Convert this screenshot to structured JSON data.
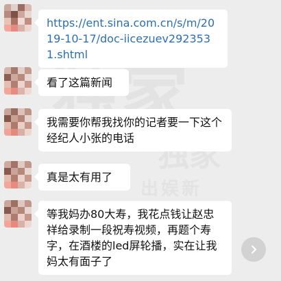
{
  "messages": [
    {
      "text": "https://ent.sina.com.cn/s/m/2019-10-17/doc-iicezuev2923531.shtml",
      "type": "link"
    },
    {
      "text": "看了这篇新闻",
      "type": "text"
    },
    {
      "text": "我需要你帮我找你的记者要一下这个经纪人小张的电话",
      "type": "text"
    },
    {
      "text": "真是太有用了",
      "type": "text"
    },
    {
      "text": "等我妈办80大寿，我花点钱让赵忠祥给录制一段祝寿视频，再题个寿字，在酒楼的led屏轮播，实在让我妈太有面子了",
      "type": "text"
    }
  ],
  "watermark": {
    "line1": "独家",
    "line2": "独家",
    "line3": "出娱新"
  },
  "colors": {
    "background": "#ededed",
    "bubble": "#ffffff",
    "link": "#2a6fb5",
    "text": "#111111"
  },
  "icons": {
    "forward": "chevron-right-icon"
  }
}
